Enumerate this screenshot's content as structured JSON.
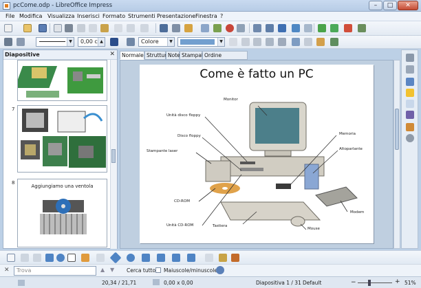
{
  "window": {
    "title": "pcCome.odp - LibreOffice Impress",
    "minimize": "–",
    "maximize": "□",
    "close": "✕"
  },
  "menu": [
    "File",
    "Modifica",
    "Visualizza",
    "Inserisci",
    "Formato",
    "Strumenti",
    "Presentazione",
    "Finestra",
    "?"
  ],
  "toolbar2": {
    "line_width": "0,00 cm",
    "area_fill": "Colore"
  },
  "slide_pane": {
    "title": "Diapositive",
    "slides": [
      {
        "number": "7"
      },
      {
        "number": "8",
        "caption": "Aggiungiamo una ventola"
      }
    ]
  },
  "view_tabs": [
    "Normale",
    "Struttura",
    "Note",
    "Stampati",
    "Ordine diapositive"
  ],
  "slide": {
    "title": "Come è fatto un PC",
    "labels": [
      "Monitor",
      "Unità disco floppy",
      "Disco floppy",
      "Stampante laser",
      "Memoria",
      "Altoparlante",
      "CD-ROM",
      "Unità CD-ROM",
      "Tastiera",
      "Mouse",
      "Modem"
    ]
  },
  "find": {
    "placeholder": "Trova",
    "find_all": "Cerca tutto",
    "match_case": "Maiuscole/minuscole"
  },
  "status": {
    "position": "20,34 / 21,71",
    "size": "0,00 x 0,00",
    "slide": "Diapositiva 1 / 31",
    "layout": "Default",
    "zoom": "51%"
  }
}
